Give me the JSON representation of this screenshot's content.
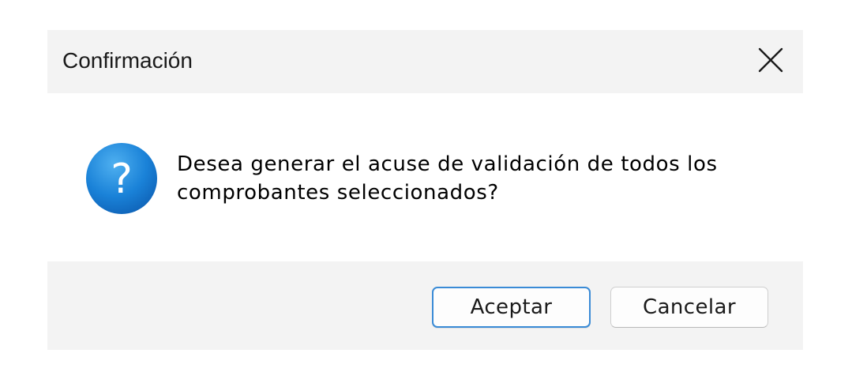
{
  "dialog": {
    "title": "Confirmación",
    "message_lines": [
      "Desea generar el acuse de validación de todos los",
      "comprobantes seleccionados?"
    ],
    "icon": "question-icon",
    "close_icon": "close-icon",
    "buttons": {
      "accept_label": "Aceptar",
      "cancel_label": "Cancelar"
    },
    "colors": {
      "titlebar_bg": "#f3f3f3",
      "footer_bg": "#f3f3f3",
      "icon_blue": "#1a7fd4",
      "accent_border": "#3a8bd6"
    }
  }
}
